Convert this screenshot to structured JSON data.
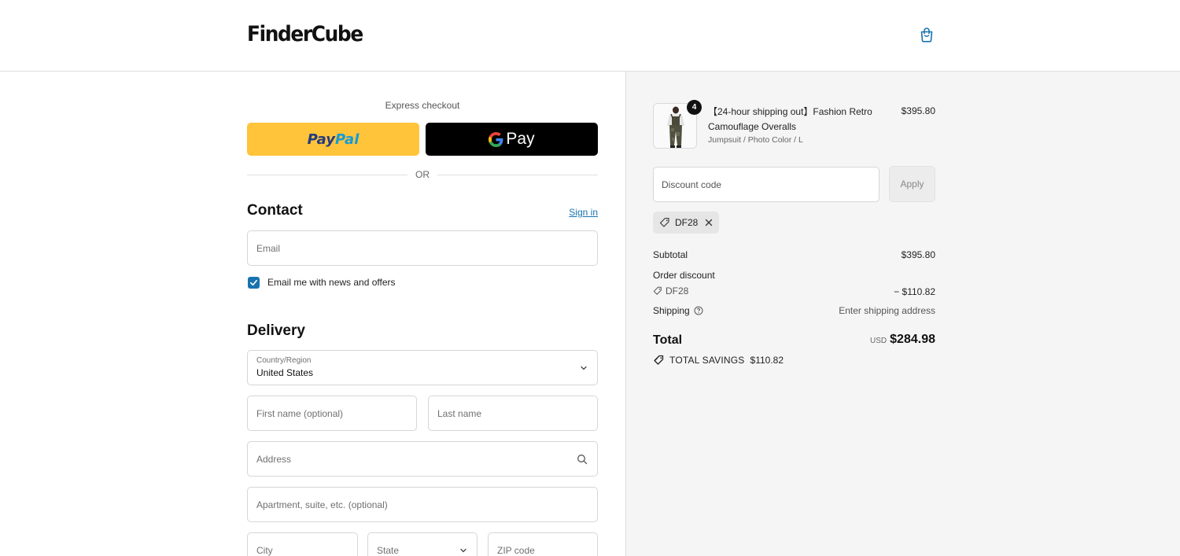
{
  "header": {
    "logo": "FinderCube",
    "cart_icon": "shopping-bag-icon"
  },
  "express": {
    "label": "Express checkout",
    "paypal_part1": "Pay",
    "paypal_part2": "Pal",
    "gpay_label": "Pay",
    "or_label": "OR"
  },
  "contact": {
    "title": "Contact",
    "sign_in": "Sign in",
    "email_placeholder": "Email",
    "newsletter_label": "Email me with news and offers",
    "newsletter_checked": true
  },
  "delivery": {
    "title": "Delivery",
    "country_label": "Country/Region",
    "country_value": "United States",
    "first_name_placeholder": "First name (optional)",
    "last_name_placeholder": "Last name",
    "address_placeholder": "Address",
    "apartment_placeholder": "Apartment, suite, etc. (optional)",
    "city_placeholder": "City",
    "state_placeholder": "State",
    "zip_placeholder": "ZIP code"
  },
  "summary": {
    "product": {
      "quantity": "4",
      "name": "【24-hour shipping out】Fashion Retro Camouflage Overalls",
      "variant": "Jumpsuit / Photo Color / L",
      "price": "$395.80"
    },
    "discount_placeholder": "Discount code",
    "apply_label": "Apply",
    "applied_code": "DF28",
    "subtotal_label": "Subtotal",
    "subtotal_value": "$395.80",
    "order_discount_label": "Order discount",
    "discount_code_label": "DF28",
    "discount_value": "− $110.82",
    "shipping_label": "Shipping",
    "shipping_value": "Enter shipping address",
    "total_label": "Total",
    "total_currency": "USD",
    "total_value": "$284.98",
    "savings_label": "TOTAL SAVINGS",
    "savings_value": "$110.82"
  },
  "colors": {
    "paypal_bg": "#ffc439",
    "link_blue": "#1773b0",
    "summary_bg": "#f5f5f5"
  }
}
